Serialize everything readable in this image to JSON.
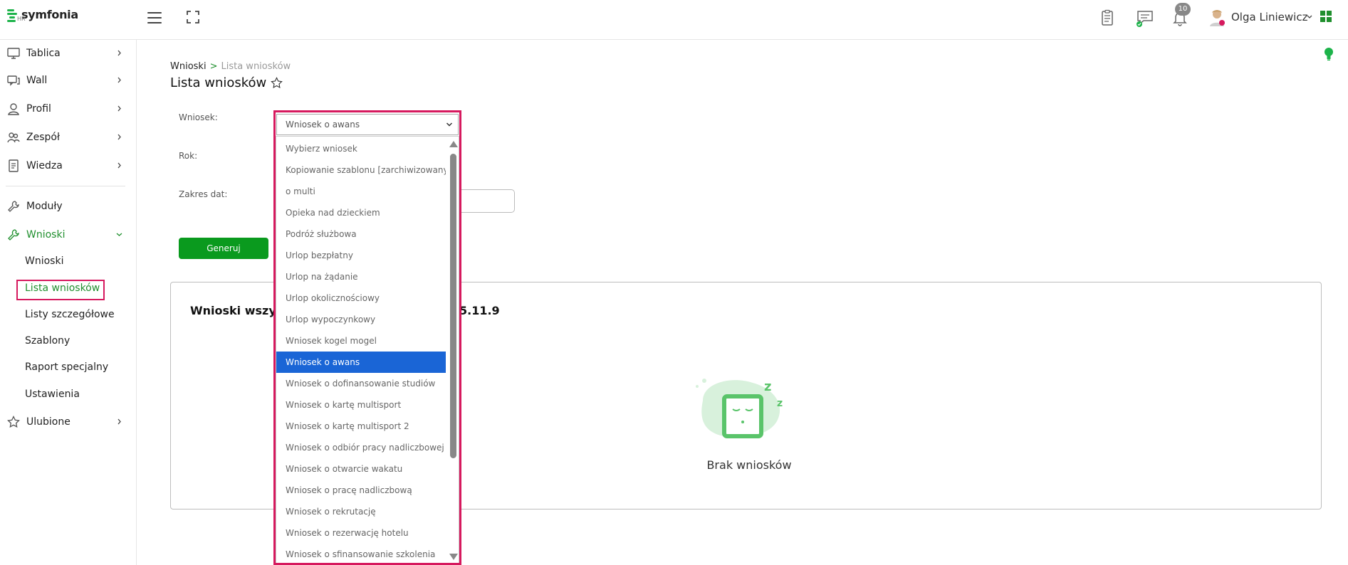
{
  "app": {
    "logo_text": "symfonia",
    "logo_sub": "HR",
    "notification_count": "10",
    "user_name": "Olga Liniewicz",
    "accent_color": "#1f8f2d",
    "highlight_color": "#d6195e",
    "selected_color": "#1a65d6"
  },
  "sidebar": {
    "items": [
      {
        "label": "Tablica",
        "icon": "monitor-icon"
      },
      {
        "label": "Wall",
        "icon": "chat-icon"
      },
      {
        "label": "Profil",
        "icon": "user-icon"
      },
      {
        "label": "Zespół",
        "icon": "team-icon"
      },
      {
        "label": "Wiedza",
        "icon": "document-icon"
      },
      {
        "label": "Moduły",
        "icon": "wrench-icon"
      },
      {
        "label": "Wnioski",
        "icon": "wrench-icon"
      },
      {
        "label": "Ulubione",
        "icon": "star-icon"
      }
    ],
    "sub_items": [
      {
        "label": "Wnioski"
      },
      {
        "label": "Lista wniosków"
      },
      {
        "label": "Listy szczegółowe"
      },
      {
        "label": "Szablony"
      },
      {
        "label": "Raport specjalny"
      },
      {
        "label": "Ustawienia"
      }
    ]
  },
  "main": {
    "breadcrumb": {
      "parent": "Wnioski",
      "separator": ">",
      "current": "Lista wniosków"
    },
    "title": "Lista wniosków",
    "form": {
      "request_label": "Wniosek:",
      "year_label": "Rok:",
      "date_range_label": "Zakres dat:",
      "selected_value": "Wniosek o awans",
      "generate_label": "Generuj"
    },
    "card": {
      "title": "Wnioski wszyst",
      "title_tail": "5.11.9",
      "empty_text": "Brak wniosków"
    }
  },
  "dropdown": {
    "options": [
      {
        "label": "Wybierz wniosek",
        "selected": false
      },
      {
        "label": "Kopiowanie szablonu [zarchiwizowany]",
        "selected": false
      },
      {
        "label": "o multi",
        "selected": false
      },
      {
        "label": "Opieka nad dzieckiem",
        "selected": false
      },
      {
        "label": "Podróż służbowa",
        "selected": false
      },
      {
        "label": "Urlop bezpłatny",
        "selected": false
      },
      {
        "label": "Urlop na żądanie",
        "selected": false
      },
      {
        "label": "Urlop okolicznościowy",
        "selected": false
      },
      {
        "label": "Urlop wypoczynkowy",
        "selected": false
      },
      {
        "label": "Wniosek kogel mogel",
        "selected": false
      },
      {
        "label": "Wniosek o awans",
        "selected": true
      },
      {
        "label": "Wniosek o dofinansowanie studiów",
        "selected": false
      },
      {
        "label": "Wniosek o kartę multisport",
        "selected": false
      },
      {
        "label": "Wniosek o kartę multisport 2",
        "selected": false
      },
      {
        "label": "Wniosek o odbiór pracy nadliczbowej",
        "selected": false
      },
      {
        "label": "Wniosek o otwarcie wakatu",
        "selected": false
      },
      {
        "label": "Wniosek o pracę nadliczbową",
        "selected": false
      },
      {
        "label": "Wniosek o rekrutację",
        "selected": false
      },
      {
        "label": "Wniosek o rezerwację hotelu",
        "selected": false
      },
      {
        "label": "Wniosek o sfinansowanie szkolenia",
        "selected": false
      }
    ]
  }
}
